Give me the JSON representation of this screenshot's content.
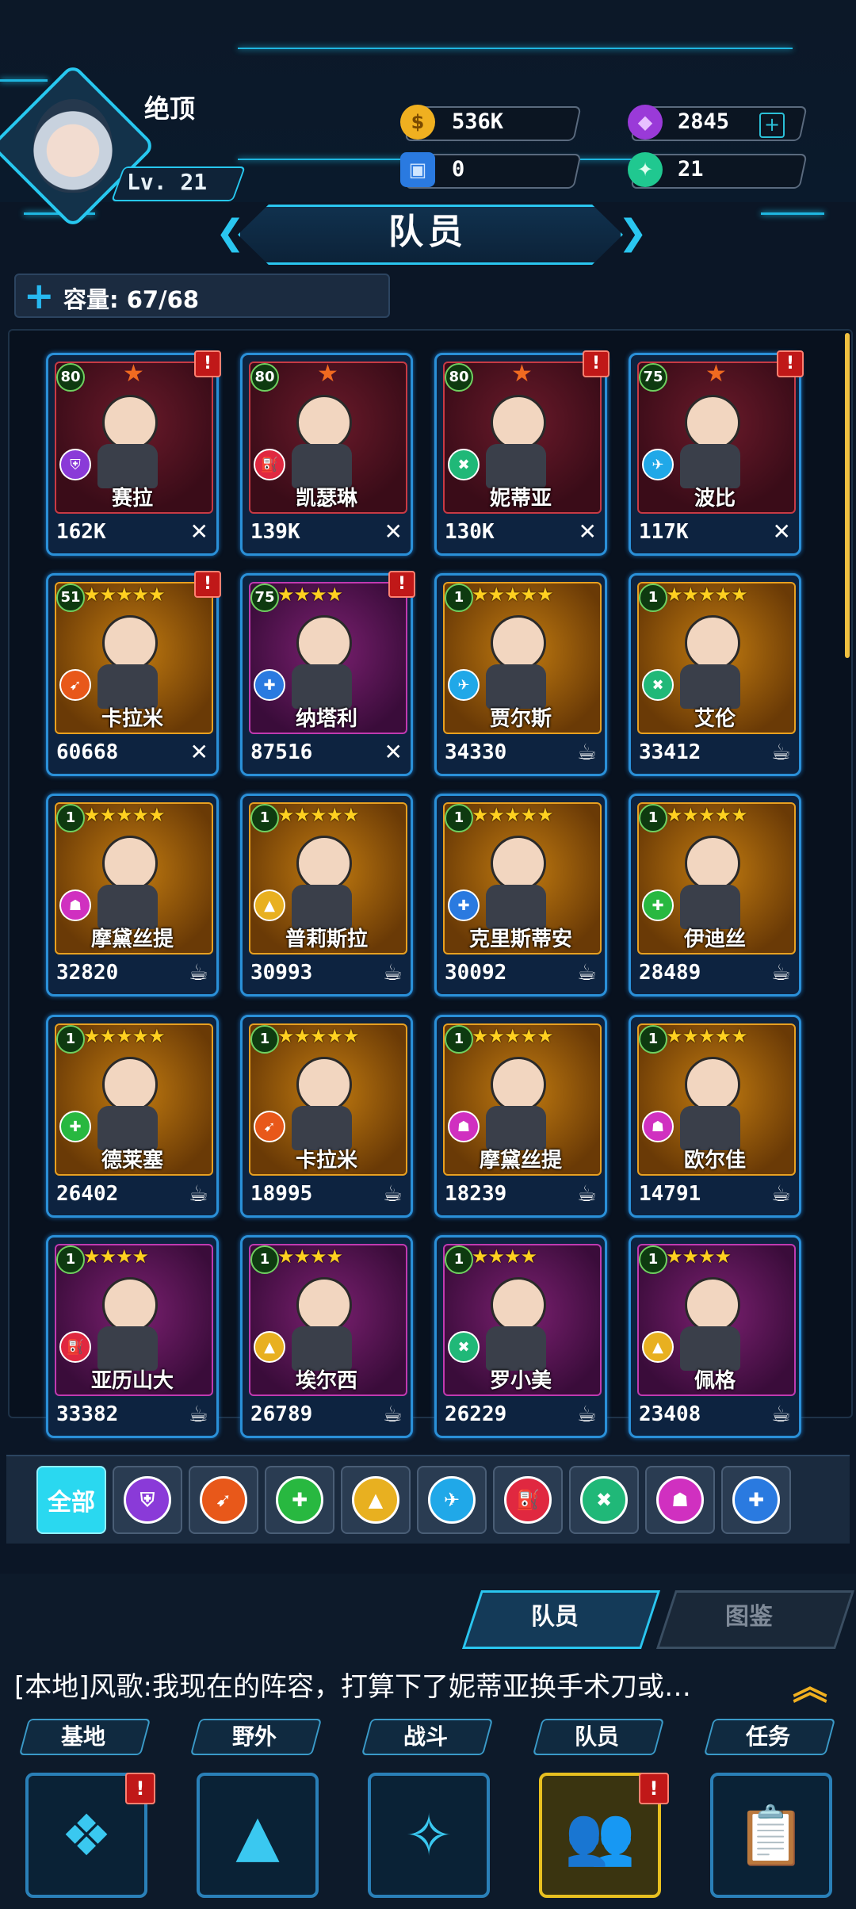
{
  "player": {
    "name": "绝顶",
    "level": "Lv. 21"
  },
  "resources": [
    {
      "id": "coins",
      "value": "536K",
      "icon": "coin-icon",
      "color": "#f0b020"
    },
    {
      "id": "gems",
      "value": "2845",
      "icon": "gem-icon",
      "color": "#9a3ad8"
    },
    {
      "id": "cubes",
      "value": "0",
      "icon": "cube-icon",
      "color": "#2a7ae0"
    },
    {
      "id": "shards",
      "value": "21",
      "icon": "shard-icon",
      "color": "#20c890"
    }
  ],
  "title": "队员",
  "capacity": "容量: 67/68",
  "members": [
    {
      "name": "赛拉",
      "power": "162K",
      "level": "80",
      "stars": "",
      "alert": "!",
      "status": "✕",
      "tier": "red",
      "role": "shield-role-icon"
    },
    {
      "name": "凯瑟琳",
      "power": "139K",
      "level": "80",
      "stars": "",
      "alert": "",
      "status": "✕",
      "tier": "red",
      "role": "fuel-role-icon"
    },
    {
      "name": "妮蒂亚",
      "power": "130K",
      "level": "80",
      "stars": "",
      "alert": "!",
      "status": "✕",
      "tier": "red",
      "role": "tools-role-icon"
    },
    {
      "name": "波比",
      "power": "117K",
      "level": "75",
      "stars": "",
      "alert": "!",
      "status": "✕",
      "tier": "red",
      "role": "rocket-role-icon"
    },
    {
      "name": "卡拉米",
      "power": "60668",
      "level": "51",
      "stars": "★★★★★",
      "alert": "!",
      "status": "✕",
      "tier": "gold",
      "role": "gun-role-icon"
    },
    {
      "name": "纳塔利",
      "power": "87516",
      "level": "75",
      "stars": "★★★★",
      "alert": "!",
      "status": "✕",
      "tier": "purple",
      "role": "medic-role-icon"
    },
    {
      "name": "贾尔斯",
      "power": "34330",
      "level": "1",
      "stars": "★★★★★",
      "alert": "",
      "status": "☕",
      "tier": "gold",
      "role": "rocket-role-icon"
    },
    {
      "name": "艾伦",
      "power": "33412",
      "level": "1",
      "stars": "★★★★★",
      "alert": "",
      "status": "☕",
      "tier": "gold",
      "role": "tools-role-icon"
    },
    {
      "name": "摩黛丝提",
      "power": "32820",
      "level": "1",
      "stars": "★★★★★",
      "alert": "",
      "status": "☕",
      "tier": "gold",
      "role": "ghost-role-icon"
    },
    {
      "name": "普莉斯拉",
      "power": "30993",
      "level": "1",
      "stars": "★★★★★",
      "alert": "",
      "status": "☕",
      "tier": "gold",
      "role": "cone-role-icon"
    },
    {
      "name": "克里斯蒂安",
      "power": "30092",
      "level": "1",
      "stars": "★★★★★",
      "alert": "",
      "status": "☕",
      "tier": "gold",
      "role": "medic-role-icon"
    },
    {
      "name": "伊迪丝",
      "power": "28489",
      "level": "1",
      "stars": "★★★★★",
      "alert": "",
      "status": "☕",
      "tier": "gold",
      "role": "syringe-role-icon"
    },
    {
      "name": "德莱塞",
      "power": "26402",
      "level": "1",
      "stars": "★★★★★",
      "alert": "",
      "status": "☕",
      "tier": "gold",
      "role": "syringe-role-icon"
    },
    {
      "name": "卡拉米",
      "power": "18995",
      "level": "1",
      "stars": "★★★★★",
      "alert": "",
      "status": "☕",
      "tier": "gold",
      "role": "gun-role-icon"
    },
    {
      "name": "摩黛丝提",
      "power": "18239",
      "level": "1",
      "stars": "★★★★★",
      "alert": "",
      "status": "☕",
      "tier": "gold",
      "role": "ghost-role-icon"
    },
    {
      "name": "欧尔佳",
      "power": "14791",
      "level": "1",
      "stars": "★★★★★",
      "alert": "",
      "status": "☕",
      "tier": "gold",
      "role": "ghost-role-icon"
    },
    {
      "name": "亚历山大",
      "power": "33382",
      "level": "1",
      "stars": "★★★★",
      "alert": "",
      "status": "☕",
      "tier": "purple",
      "role": "fuel-role-icon"
    },
    {
      "name": "埃尔西",
      "power": "26789",
      "level": "1",
      "stars": "★★★★",
      "alert": "",
      "status": "☕",
      "tier": "purple",
      "role": "cone-role-icon"
    },
    {
      "name": "罗小美",
      "power": "26229",
      "level": "1",
      "stars": "★★★★",
      "alert": "",
      "status": "☕",
      "tier": "purple",
      "role": "tools-role-icon"
    },
    {
      "name": "佩格",
      "power": "23408",
      "level": "1",
      "stars": "★★★★",
      "alert": "",
      "status": "☕",
      "tier": "purple",
      "role": "cone-role-icon"
    }
  ],
  "filters": {
    "all_label": "全部",
    "icons": [
      "shield-role-icon",
      "gun-role-icon",
      "syringe-role-icon",
      "cone-role-icon",
      "rocket-role-icon",
      "fuel-role-icon",
      "tools-role-icon",
      "ghost-role-icon",
      "medic-role-icon"
    ]
  },
  "tabs": {
    "members": "队员",
    "gallery": "图鉴"
  },
  "chat": "[本地]风歌:我现在的阵容，打算下了妮蒂亚换手术刀或…",
  "nav": [
    {
      "label": "基地",
      "icon": "crystal-icon",
      "alert": "!"
    },
    {
      "label": "野外",
      "icon": "mountain-icon",
      "alert": ""
    },
    {
      "label": "战斗",
      "icon": "emblem-icon",
      "alert": ""
    },
    {
      "label": "队员",
      "icon": "team-icon",
      "alert": "!"
    },
    {
      "label": "任务",
      "icon": "clipboard-icon",
      "alert": ""
    }
  ]
}
